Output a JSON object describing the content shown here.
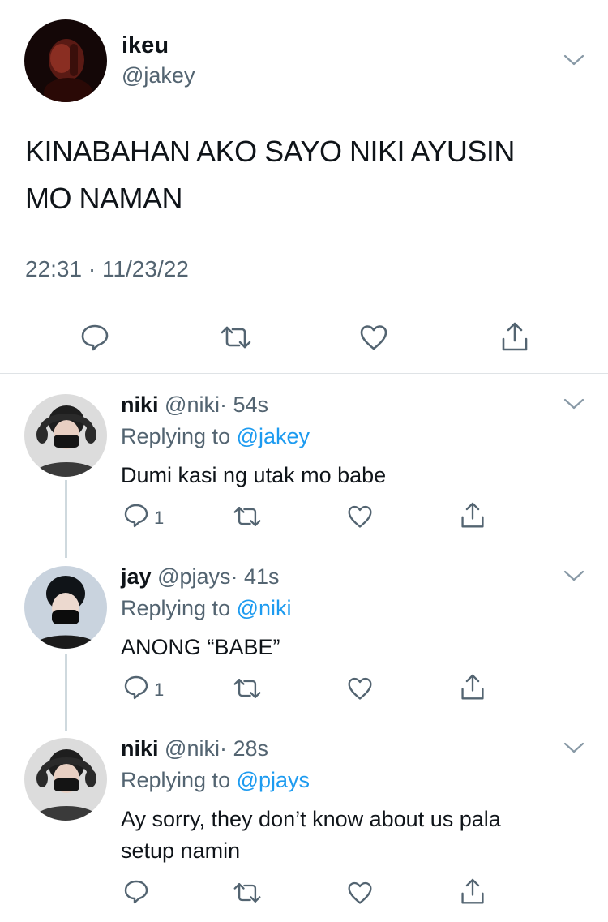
{
  "main_tweet": {
    "display_name": "ikeu",
    "handle": "@jakey",
    "text_line1": "KINABAHAN AKO SAYO NIKI AYUSIN",
    "text_line2": "MO NAMAN",
    "timestamp": "22:31 · 11/23/22",
    "avatar_icon": "avatar-dark-portrait"
  },
  "replies": [
    {
      "display_name": "niki",
      "handle": "@niki",
      "time": "· 54s",
      "replying_prefix": "Replying to",
      "replying_to": "@jakey",
      "text_line1": "Dumi kasi ng utak mo babe",
      "text_line2": "",
      "reply_count": "1"
    },
    {
      "display_name": "jay",
      "handle": "@pjays",
      "time": "· 41s",
      "replying_prefix": "Replying to",
      "replying_to": "@niki",
      "text_line1": "ANONG “BABE”",
      "text_line2": "",
      "reply_count": "1"
    },
    {
      "display_name": "niki",
      "handle": "@niki",
      "time": "· 28s",
      "replying_prefix": "Replying to",
      "replying_to": "@pjays",
      "text_line1": "Ay sorry, they don’t know about us pala",
      "text_line2": "setup namin",
      "reply_count": ""
    }
  ],
  "colors": {
    "text": "#0f1419",
    "secondary": "#536471",
    "link": "#1d9bf0",
    "divider": "#dfe3e6"
  }
}
